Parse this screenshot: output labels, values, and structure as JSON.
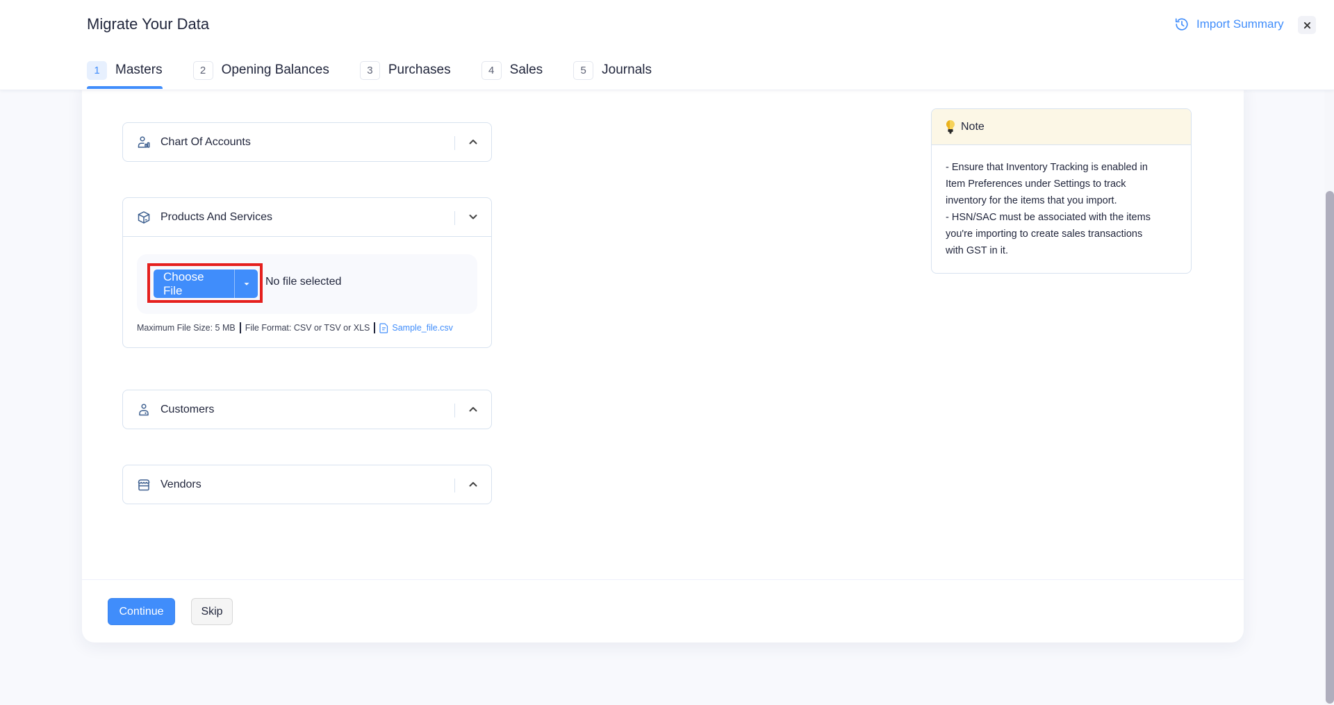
{
  "header": {
    "title": "Migrate Your Data",
    "import_summary": {
      "label": "Import Summary",
      "icon": "history-icon"
    },
    "close": {
      "icon": "close-icon"
    }
  },
  "tabs": [
    {
      "num": "1",
      "label": "Masters",
      "active": true
    },
    {
      "num": "2",
      "label": "Opening Balances",
      "active": false
    },
    {
      "num": "3",
      "label": "Purchases",
      "active": false
    },
    {
      "num": "4",
      "label": "Sales",
      "active": false
    },
    {
      "num": "5",
      "label": "Journals",
      "active": false
    }
  ],
  "sections": [
    {
      "title": "Chart Of Accounts",
      "icon": "chart-of-accounts-icon",
      "expanded": false
    },
    {
      "title": "Products And Services",
      "icon": "box-icon",
      "expanded": true
    },
    {
      "title": "Customers",
      "icon": "user-icon",
      "expanded": false
    },
    {
      "title": "Vendors",
      "icon": "store-icon",
      "expanded": false
    }
  ],
  "upload": {
    "choose_file_label": "Choose File",
    "status": "No file selected",
    "max_size": "Maximum File Size: 5 MB",
    "file_format": "File Format: CSV or TSV or XLS",
    "sample_file": "Sample_file.csv"
  },
  "note": {
    "title": "Note",
    "lines": [
      "- Ensure that Inventory Tracking is enabled in",
      "Item Preferences under Settings to track",
      "inventory for the items that you import.",
      "- HSN/SAC must be associated with the items",
      "you're importing to create sales transactions",
      "with GST in it."
    ]
  },
  "footer": {
    "continue_label": "Continue",
    "skip_label": "Skip"
  },
  "colors": {
    "accent": "#408dfb",
    "highlight": "#e5201e",
    "note_header_bg": "#fcf7e6"
  }
}
